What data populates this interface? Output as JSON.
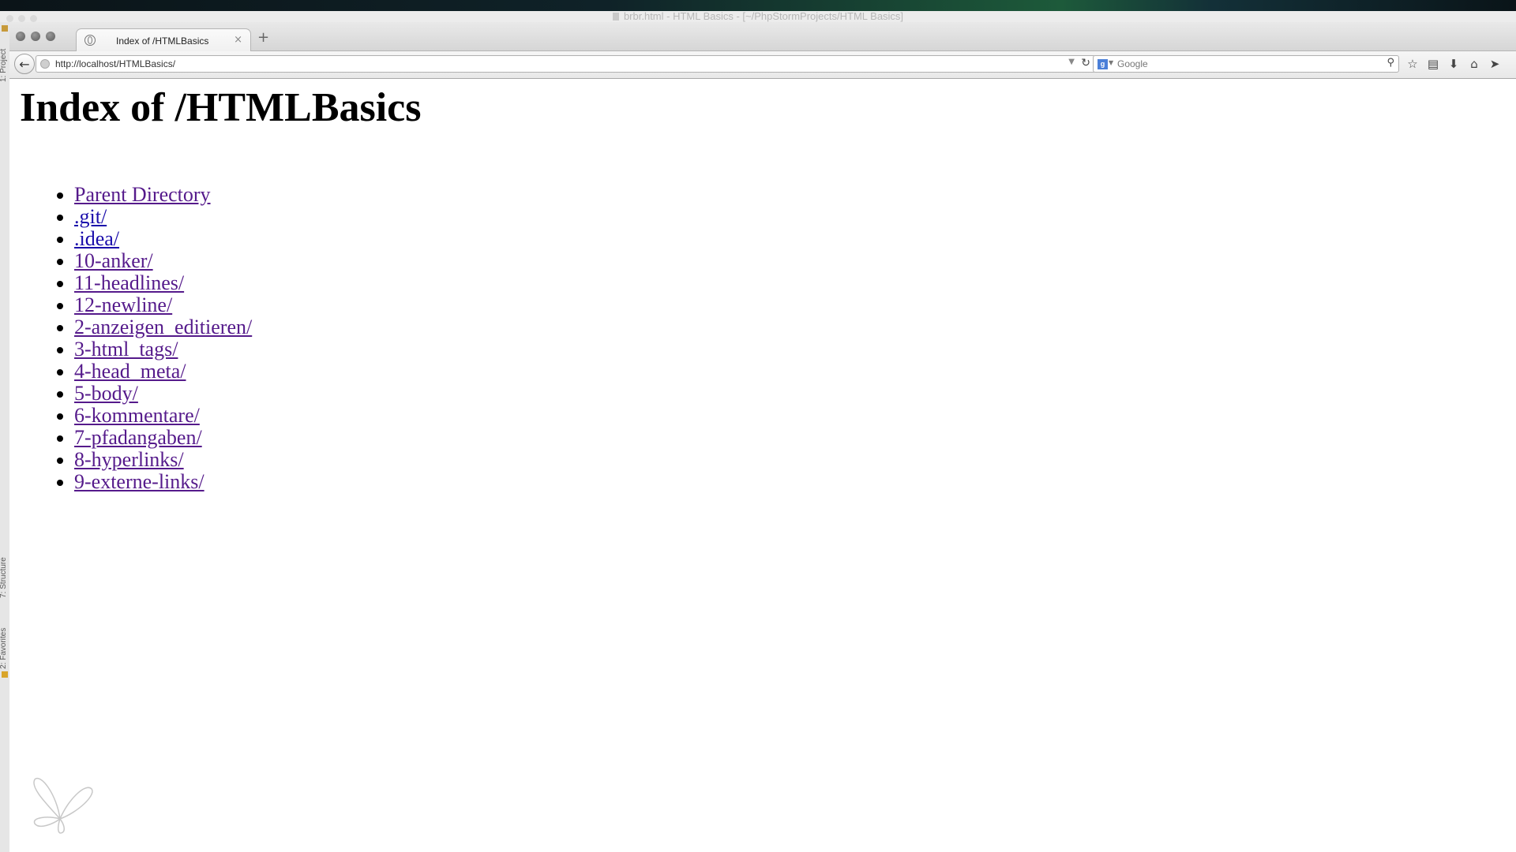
{
  "ide": {
    "window_title": "brbr.html - HTML Basics - [~/PhpStormProjects/HTML Basics]",
    "left_tools": [
      "1: Project",
      "7: Structure",
      "2: Favorites"
    ]
  },
  "browser": {
    "tab_title": "Index of /HTMLBasics",
    "new_tab_symbol": "+",
    "close_symbol": "×",
    "url": "http://localhost/HTMLBasics/",
    "search_engine": "Google",
    "search_placeholder": "Google",
    "toolbar_icons": [
      "star-icon",
      "reading-list-icon",
      "download-icon",
      "home-icon",
      "send-icon"
    ]
  },
  "page": {
    "heading": "Index of /HTMLBasics",
    "links": [
      {
        "label": "Parent Directory",
        "visited": true
      },
      {
        "label": ".git/",
        "visited": false
      },
      {
        "label": ".idea/",
        "visited": false
      },
      {
        "label": "10-anker/",
        "visited": true
      },
      {
        "label": "11-headlines/",
        "visited": true
      },
      {
        "label": "12-newline/",
        "visited": true
      },
      {
        "label": "2-anzeigen_editieren/",
        "visited": true
      },
      {
        "label": "3-html_tags/",
        "visited": true
      },
      {
        "label": "4-head_meta/",
        "visited": true
      },
      {
        "label": "5-body/",
        "visited": true
      },
      {
        "label": "6-kommentare/",
        "visited": true
      },
      {
        "label": "7-pfadangaben/",
        "visited": true
      },
      {
        "label": "8-hyperlinks/",
        "visited": true
      },
      {
        "label": "9-externe-links/",
        "visited": true
      }
    ]
  },
  "colors": {
    "link": "#1a0dab",
    "visited_link": "#551a8b"
  }
}
